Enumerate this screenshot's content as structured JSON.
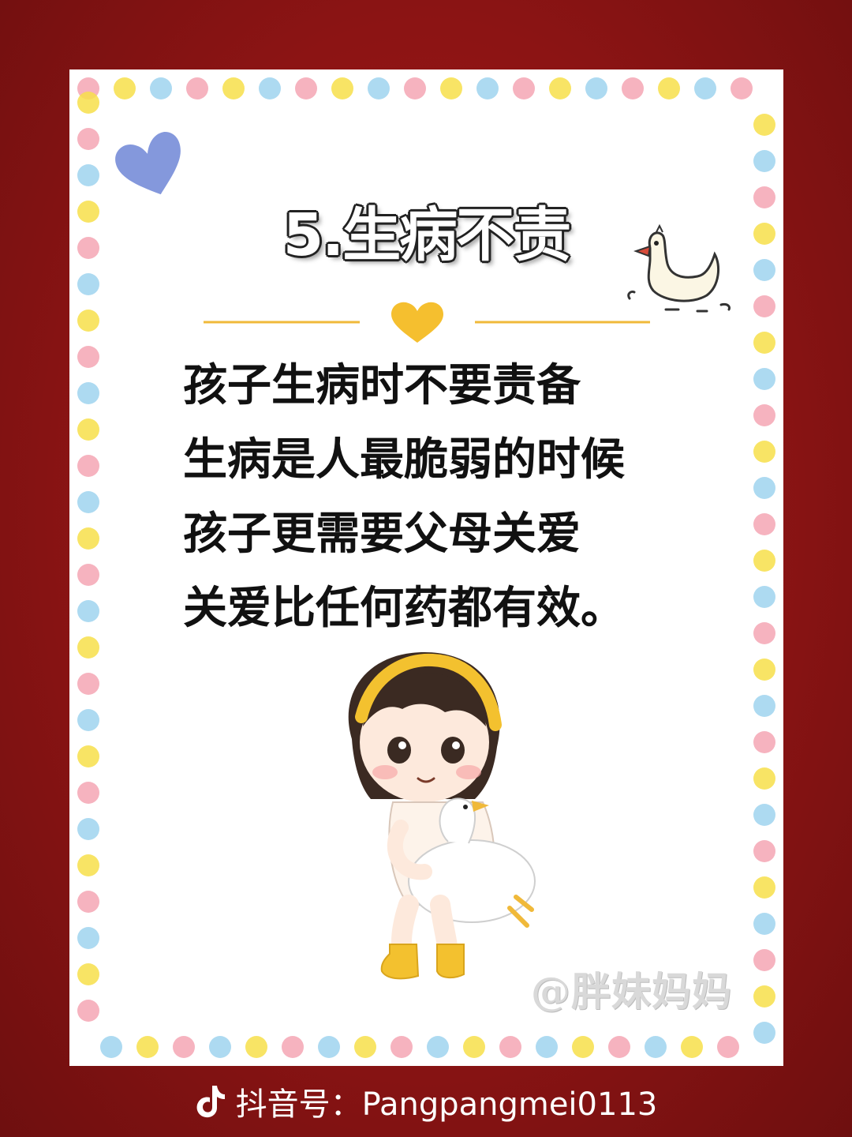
{
  "title": "5.生病不责",
  "lines": [
    "孩子生病时不要责备",
    "生病是人最脆弱的时候",
    "孩子更需要父母关爱",
    "关爱比任何药都有效。"
  ],
  "watermark": "@胖妹妈妈",
  "footer": {
    "label": "抖音号：Pangpangmei0113",
    "icon": "tiktok-icon"
  },
  "colors": {
    "background": "#8c1414",
    "card": "#ffffff",
    "divider_gold": "#f0b93a",
    "dot_pink": "#f4a6b4",
    "dot_yellow": "#f7df4a",
    "dot_blue": "#9fd3ee",
    "heart_blue": "#6f86d6"
  },
  "icons": [
    "heart-blue-icon",
    "goose-icon",
    "heart-gold-icon",
    "girl-with-goose-illustration"
  ]
}
